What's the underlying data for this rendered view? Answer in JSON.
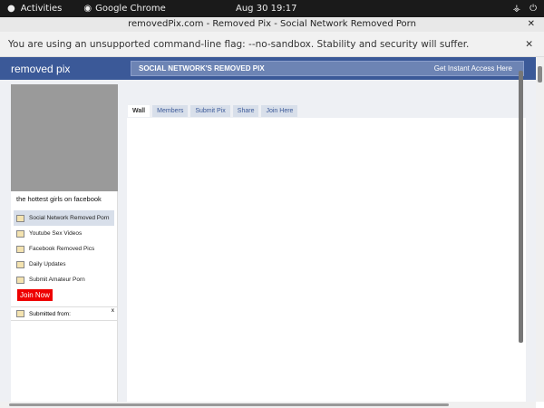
{
  "os": {
    "activities": "Activities",
    "app": "Google Chrome",
    "clock": "Aug 30  19:17"
  },
  "window": {
    "title": "removedPix.com - Removed Pix - Social Network Removed Porn"
  },
  "infobar": {
    "message": "You are using an unsupported command-line flag: --no-sandbox. Stability and security will suffer."
  },
  "header": {
    "logo": "removed pix",
    "tagline": "SOCIAL NETWORK'S REMOVED PIX",
    "cta": "Get Instant Access Here"
  },
  "profile": {
    "caption": "the hottest girls on facebook"
  },
  "menu": [
    {
      "label": "Social Network Removed Porn",
      "icon": "page-icon"
    },
    {
      "label": "Youtube Sex Videos",
      "icon": "video-icon"
    },
    {
      "label": "Facebook Removed Pics",
      "icon": "photo-icon"
    },
    {
      "label": "Daily Updates",
      "icon": "calendar-icon"
    },
    {
      "label": "Submit Amateur Porn",
      "icon": "upload-icon"
    }
  ],
  "join": "Join Now",
  "submitted": {
    "label": "Submitted from:",
    "close": "x"
  },
  "tabs": [
    "Wall",
    "Members",
    "Submit Pix",
    "Share",
    "Join Here"
  ],
  "colors": {
    "brand": "#3b5998",
    "join": "#ee0000"
  }
}
